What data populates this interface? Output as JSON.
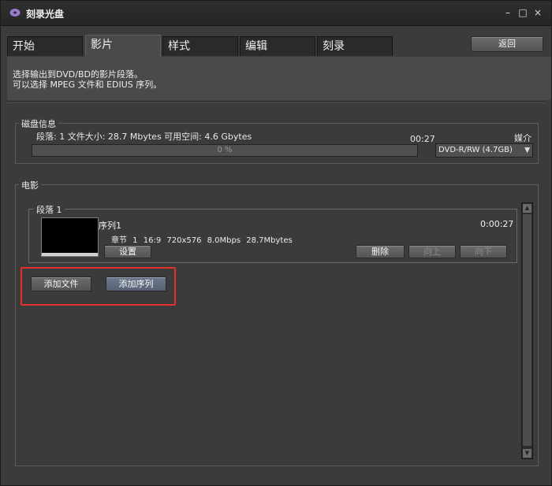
{
  "window": {
    "title": "刻录光盘",
    "controls": {
      "minimize": "–",
      "maximize": "□",
      "close": "×"
    }
  },
  "tabs": [
    {
      "label": "开始",
      "active": false
    },
    {
      "label": "影片",
      "active": true
    },
    {
      "label": "样式",
      "active": false
    },
    {
      "label": "编辑",
      "active": false
    },
    {
      "label": "刻录",
      "active": false
    }
  ],
  "toolbar": {
    "return_label": "返回"
  },
  "description": {
    "line1": "选择输出到DVD/BD的影片段落。",
    "line2": "可以选择 MPEG 文件和 EDIUS 序列。"
  },
  "disk": {
    "group_label": "磁盘信息",
    "info": "段落: 1  文件大小: 28.7 Mbytes  可用空间: 4.6 Gbytes",
    "time": "00:27",
    "media_label": "媒介",
    "progress_percent": 0,
    "progress_text": "0 %",
    "media_selected": "DVD-R/RW (4.7GB)"
  },
  "movie": {
    "group_label": "电影",
    "segment": {
      "label": "段落 1",
      "sequence_name": "序列1",
      "duration": "0:00:27",
      "meta": "章节 1  16:9  720x576  8.0Mbps  28.7Mbytes",
      "settings_label": "设置",
      "delete_label": "删除",
      "up_label": "向上",
      "down_label": "向下"
    },
    "add_file_label": "添加文件",
    "add_sequence_label": "添加序列"
  },
  "colors": {
    "highlight": "#e53030",
    "background": "#3b3b3b"
  }
}
